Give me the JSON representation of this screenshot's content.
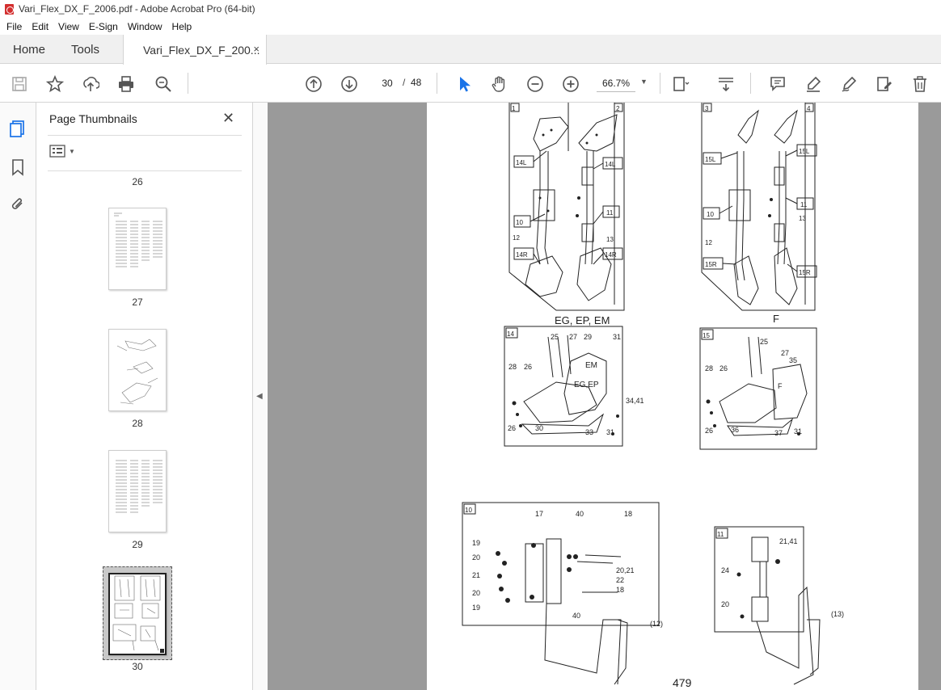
{
  "window": {
    "title": "Vari_Flex_DX_F_2006.pdf - Adobe Acrobat Pro (64-bit)"
  },
  "menu": [
    "File",
    "Edit",
    "View",
    "E-Sign",
    "Window",
    "Help"
  ],
  "tabs": {
    "home": "Home",
    "tools": "Tools",
    "document": "Vari_Flex_DX_F_200...",
    "close": "×"
  },
  "toolbar": {
    "page_current": "30",
    "page_sep": "/",
    "page_total": "48",
    "zoom": "66.7%",
    "icons": [
      "save-icon",
      "bookmark-star-icon",
      "share-upload-icon",
      "print-icon",
      "zoom-search-icon",
      "prev-page-icon",
      "next-page-icon",
      "select-cursor-icon",
      "hand-icon",
      "zoom-out-icon",
      "zoom-in-icon",
      "page-fit-icon",
      "scroll-mode-icon",
      "comment-icon",
      "highlight-icon",
      "sign-icon",
      "edit-pdf-icon",
      "delete-icon"
    ]
  },
  "sidebar": {
    "title": "Page Thumbnails",
    "close": "✕",
    "thumbnails": [
      {
        "label": "26"
      },
      {
        "label": "27"
      },
      {
        "label": "28"
      },
      {
        "label": "29"
      },
      {
        "label": "30",
        "selected": true
      }
    ]
  },
  "document": {
    "label_eg": "EG, EP, EM",
    "label_f": "F",
    "page_number": "479",
    "boxes": [
      "1",
      "2",
      "3",
      "4",
      "14",
      "15",
      "10",
      "11"
    ],
    "callouts_top": [
      "14L",
      "10",
      "12",
      "14R",
      "14L",
      "11",
      "13",
      "14R",
      "15L",
      "10",
      "12",
      "15R",
      "15L",
      "11",
      "13",
      "15R"
    ],
    "callouts_14": [
      "25",
      "27",
      "29",
      "31",
      "28",
      "26",
      "EM",
      "EG,EP",
      "34,41",
      "26",
      "30",
      "33",
      "31"
    ],
    "callouts_15": [
      "25",
      "27",
      "28",
      "26",
      "35",
      "F",
      "26",
      "36",
      "37",
      "31"
    ],
    "callouts_10": [
      "17",
      "40",
      "18",
      "19",
      "20",
      "21",
      "20",
      "19",
      "20,21",
      "22",
      "18",
      "40",
      "(12)"
    ],
    "callouts_11": [
      "21,41",
      "24",
      "20",
      "(13)"
    ]
  }
}
